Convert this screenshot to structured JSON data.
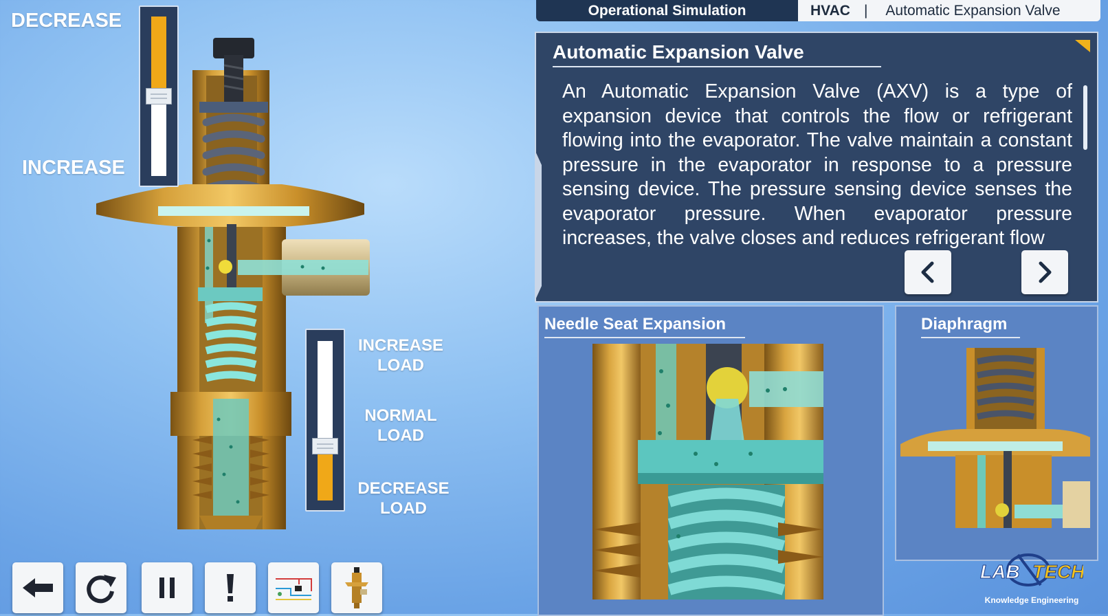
{
  "header": {
    "mode_tab": "Operational Simulation",
    "category": "HVAC",
    "separator": "|",
    "topic": "Automatic Expansion Valve"
  },
  "info": {
    "title": "Automatic Expansion Valve",
    "body": "An Automatic Expansion Valve (AXV) is a type of expansion device that controls the flow or refrigerant flowing into the evaporator. The valve maintain a constant pressure in the evaporator in response to a pressure sensing device. The pressure sensing device senses the evaporator pressure. When evaporator pressure increases, the valve closes and reduces refrigerant flow"
  },
  "panels": {
    "needle_title": "Needle Seat Expansion",
    "diaphragm_title": "Diaphragm"
  },
  "spring_slider": {
    "top_label": "DECREASE",
    "bottom_label": "INCREASE",
    "level": 0.5
  },
  "load_slider": {
    "top_label_1": "INCREASE",
    "top_label_2": "LOAD",
    "mid_label_1": "NORMAL",
    "mid_label_2": "LOAD",
    "bottom_label_1": "DECREASE",
    "bottom_label_2": "LOAD",
    "level": 0.34
  },
  "toolbar": {
    "back_icon": "arrow-left-icon",
    "reset_icon": "redo-icon",
    "pause_icon": "pause-icon",
    "info_icon": "exclamation-icon",
    "circuit_icon": "circuit-diagram-icon",
    "valve_icon": "valve-thumbnail-icon"
  },
  "logo": {
    "brand_left": "LAB",
    "brand_right": "TECH",
    "tagline": "Knowledge Engineering"
  },
  "colors": {
    "accent": "#f0a818",
    "panel": "#2f4566",
    "brass": "#c9902f",
    "fluid": "#5fd0c8"
  }
}
